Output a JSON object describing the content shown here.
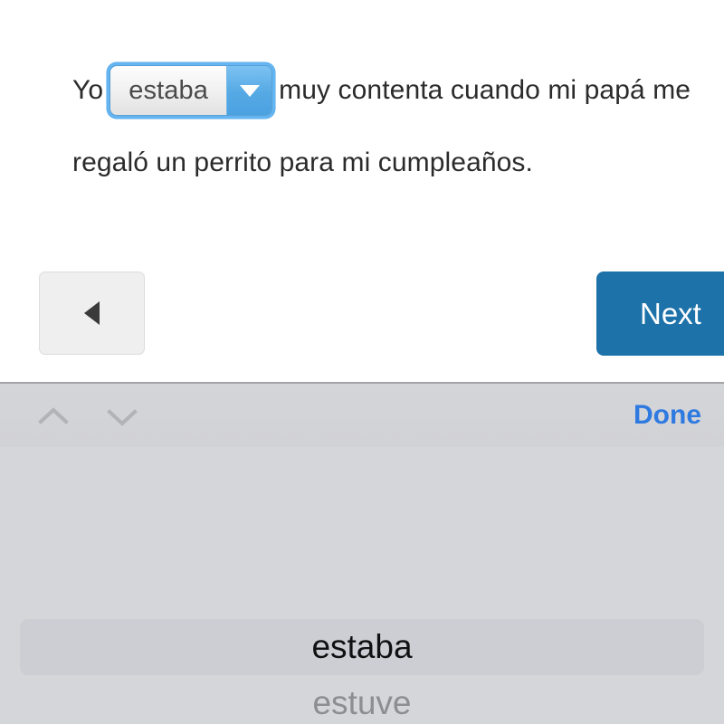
{
  "exercise": {
    "sentence_before": "Yo",
    "sentence_after": "muy contenta cuando mi papá me",
    "sentence_line2": "regaló un perrito para mi cumpleaños.",
    "select_value": "estaba",
    "select_caret_icon": "caret-down-icon"
  },
  "nav": {
    "back_icon": "caret-left-icon",
    "next_label": "Next"
  },
  "accessory": {
    "prev_icon": "chevron-up-icon",
    "next_icon": "chevron-down-icon",
    "done_label": "Done"
  },
  "picker": {
    "options": [
      {
        "label": "estaba",
        "selected": true
      },
      {
        "label": "estuve",
        "selected": false
      }
    ]
  },
  "colors": {
    "accent_blue": "#2f7ae0",
    "next_blue": "#1c72a9",
    "focus_ring": "#64b5f1",
    "toolbar_gray": "#d4d5d8",
    "picker_gray": "#d5d6da",
    "picker_highlight": "#cdced3"
  }
}
